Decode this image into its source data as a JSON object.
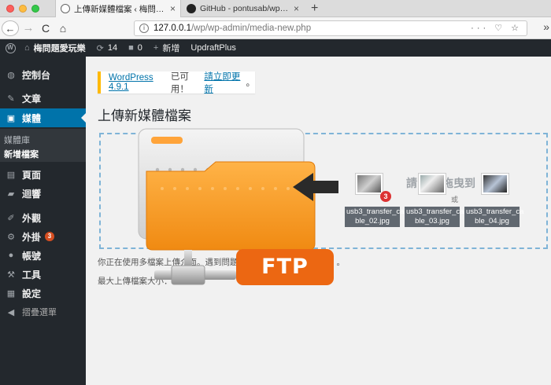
{
  "browser": {
    "tabs": [
      {
        "title": "上傳新媒體檔案 ‹ 梅問題愛玩樂 —",
        "active": true
      },
      {
        "title": "GitHub - pontusab/wp-ftp-med",
        "active": false
      }
    ],
    "url_host": "127.0.0.1",
    "url_path": "/wp/wp-admin/media-new.php",
    "url_actions": "··· ♡ ☆",
    "tab_close": "×",
    "new_tab": "+",
    "nav_back": "←",
    "nav_forward": "→",
    "nav_reload": "C",
    "nav_home": "⌂",
    "overflow": "»"
  },
  "adminbar": {
    "site_name": "梅問題愛玩樂",
    "updates_count": "14",
    "comments_count": "0",
    "new_label": "新增",
    "plugin": "UpdraftPlus",
    "wp_logo": "W",
    "home_glyph": "⌂",
    "update_glyph": "⟳",
    "comment_glyph": "■",
    "plus_glyph": "+"
  },
  "sidebar": {
    "items": [
      {
        "label": "控制台",
        "icon": "◍"
      },
      {
        "label": "文章",
        "icon": "✎"
      },
      {
        "label": "媒體",
        "icon": "▣"
      },
      {
        "label": "頁面",
        "icon": "▤"
      },
      {
        "label": "迴響",
        "icon": "▰"
      },
      {
        "label": "外觀",
        "icon": "✐"
      },
      {
        "label": "外掛",
        "icon": "⚙",
        "badge": "3"
      },
      {
        "label": "帳號",
        "icon": "●"
      },
      {
        "label": "工具",
        "icon": "⚒"
      },
      {
        "label": "設定",
        "icon": "▦"
      },
      {
        "label": "摺疊選單",
        "icon": "◀"
      }
    ],
    "submenu": [
      "媒體庫",
      "新增檔案"
    ]
  },
  "notice": {
    "version_link": "WordPress 4.9.1",
    "available": " 已可用！",
    "update_link": "請立即更新",
    "end": "。"
  },
  "page": {
    "title": "上傳新媒體檔案",
    "drop_instruction": "請",
    "drop_instruction_tail": "拖曳到",
    "drop_or": "或",
    "info_line1": "你正在使用多檔案上傳介面。遇到問題了？",
    "info_line1_end": "。",
    "info_line2": "最大上傳檔案大小："
  },
  "uploads": [
    {
      "name1": "usb3_transfer_ca",
      "name2": "ble_02.jpg",
      "badge": "3"
    },
    {
      "name1": "usb3_transfer_ca",
      "name2": "ble_03.jpg"
    },
    {
      "name1": "usb3_transfer_ca",
      "name2": "ble_04.jpg"
    }
  ],
  "overlay": {
    "ftp_label": "FTP"
  },
  "colors": {
    "wp_blue": "#0073aa",
    "admin_dark": "#23282d",
    "notice_yellow": "#ffb900",
    "ftp_orange": "#ec6712",
    "dropzone_border": "#7fb4d7"
  }
}
